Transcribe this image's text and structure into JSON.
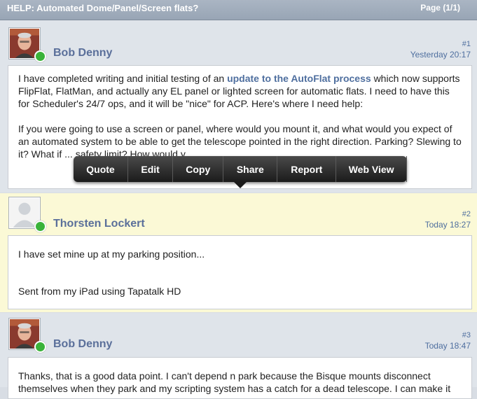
{
  "header": {
    "title": "HELP: Automated Dome/Panel/Screen flats?",
    "page": "Page (1/1)"
  },
  "posts": [
    {
      "author": "Bob Denny",
      "number": "#1",
      "time": "Yesterday 20:17",
      "text1_pre": "I have completed writing and initial testing of an",
      "link": "update to the AutoFlat process",
      "text1_post": "which now supports FlipFlat, FlatMan, and actually any EL panel or lighted screen for automatic flats. I need to have this for Scheduler's 24/7 ops, and it will be \"nice\" for ACP. Here's where I need help:",
      "text2": "If you were going to use a screen or panel, where would you mount it, and what would you expect of an automated system to be able to get the telescope pointed in the right direction. Parking? Slewing to it? What if ... safety limit? How would y..."
    },
    {
      "author": "Thorsten Lockert",
      "number": "#2",
      "time": "Today 18:27",
      "text1": "I have set mine up at my parking position...",
      "text2": "Sent from my iPad using Tapatalk HD"
    },
    {
      "author": "Bob Denny",
      "number": "#3",
      "time": "Today 18:47",
      "text1": "Thanks, that is a good data point. I can't depend n park because the Bisque mounts disconnect themselves when they park and my scripting system has a catch for a dead telescope. I can make it"
    }
  ],
  "popup": {
    "buttons": [
      "Quote",
      "Edit",
      "Copy",
      "Share",
      "Report",
      "Web View"
    ]
  },
  "colors": {
    "highlight": "#fbf9d6",
    "online": "#3ab33a",
    "accent": "#5a6f9a"
  }
}
